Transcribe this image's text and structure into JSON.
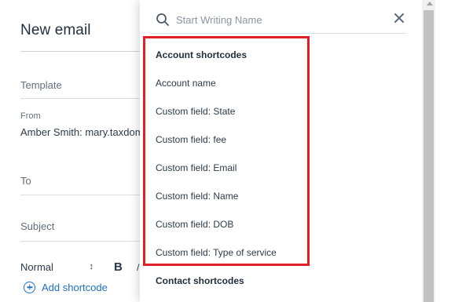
{
  "compose": {
    "title": "New email",
    "template_label": "Template",
    "from_label": "From",
    "from_value": "Amber Smith: mary.taxdome",
    "to_label": "To",
    "subject_label": "Subject",
    "format_value": "Normal",
    "bold_label": "B",
    "extra_glyph": "/",
    "add_shortcode_label": "Add shortcode"
  },
  "dropdown": {
    "search_placeholder": "Start Writing Name",
    "account_header": "Account shortcodes",
    "account_items": [
      "Account name",
      "Custom field: State",
      "Custom field: fee",
      "Custom field: Email",
      "Custom field: Name",
      "Custom field: DOB",
      "Custom field: Type of service"
    ],
    "contact_header": "Contact shortcodes"
  },
  "icons": {
    "search": "search-icon",
    "clear": "close-icon",
    "add": "plus-circle-icon",
    "select_caret": "chevron-up-down-icon"
  },
  "colors": {
    "accent": "#1f6fc0",
    "highlight": "#e01f26",
    "text": "#2b3a4a",
    "muted": "#5f6f80"
  }
}
